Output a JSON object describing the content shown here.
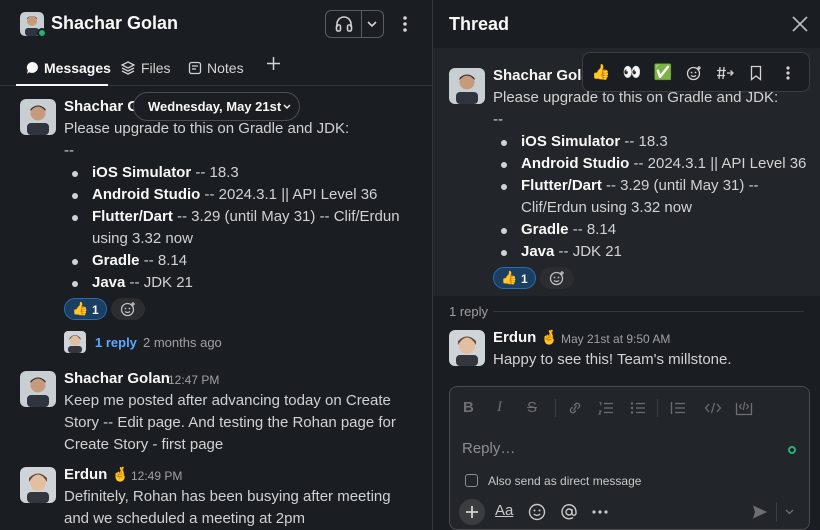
{
  "channel": {
    "title": "Shachar Golan",
    "tabs": [
      {
        "label": "Messages",
        "icon": "message-icon"
      },
      {
        "label": "Files",
        "icon": "layers-icon"
      },
      {
        "label": "Notes",
        "icon": "notes-icon"
      }
    ],
    "date_pill": "Wednesday, May 21st",
    "messages": [
      {
        "author": "Shachar G",
        "lines": [
          "Please upgrade to this on Gradle and JDK:",
          "--"
        ],
        "bullets": [
          {
            "bold": "iOS Simulator",
            "rest": " -- 18.3"
          },
          {
            "bold": "Android Studio",
            "rest": " -- 2024.3.1 || API Level 36"
          },
          {
            "bold": "Flutter/Dart",
            "rest": " -- 3.29 (until May 31) -- Clif/Erdun",
            "cont": "using 3.32 now"
          },
          {
            "bold": "Gradle",
            "rest": " -- 8.14"
          },
          {
            "bold": "Java",
            "rest": " -- JDK 21"
          }
        ],
        "reaction": {
          "emoji": "👍",
          "count": "1"
        },
        "reply_count": "1 reply",
        "reply_ago": "2 months ago"
      },
      {
        "author": "Shachar Golan",
        "time": "12:47 PM",
        "lines": [
          "Keep me posted after advancing today on Create",
          "Story -- Edit page. And testing the Rohan page for",
          "Create Story - first page"
        ]
      },
      {
        "author": "Erdun",
        "author_emoji": "🤞",
        "time": "12:49 PM",
        "lines": [
          "Definitely, Rohan has been busying after meeting",
          "and we scheduled a meeting at 2pm"
        ]
      }
    ]
  },
  "thread": {
    "title": "Thread",
    "toolbar_emojis": [
      "👍",
      "👀",
      "✅"
    ],
    "parent": {
      "author": "Shachar Golan",
      "lines": [
        "Please upgrade to this on Gradle and JDK:",
        "--"
      ],
      "bullets": [
        {
          "bold": "iOS Simulator",
          "rest": " -- 18.3"
        },
        {
          "bold": "Android Studio",
          "rest": " -- 2024.3.1 || API Level 36"
        },
        {
          "bold": "Flutter/Dart",
          "rest": " -- 3.29 (until May 31) --",
          "cont": "Clif/Erdun using 3.32 now"
        },
        {
          "bold": "Gradle",
          "rest": " -- 8.14"
        },
        {
          "bold": "Java",
          "rest": " -- JDK 21"
        }
      ],
      "reaction": {
        "emoji": "👍",
        "count": "1"
      }
    },
    "reply_count": "1 reply",
    "reply": {
      "author": "Erdun",
      "author_emoji": "🤞",
      "time": "May 21st at 9:50 AM",
      "text": "Happy to see this! Team's millstone."
    },
    "composer": {
      "placeholder": "Reply…",
      "checkbox_label": "Also send as direct message"
    }
  },
  "colors": {
    "background": "#1a1d21",
    "link": "#5aa9ff",
    "presence": "#2bac76",
    "reaction_bg": "#1b3e63"
  }
}
